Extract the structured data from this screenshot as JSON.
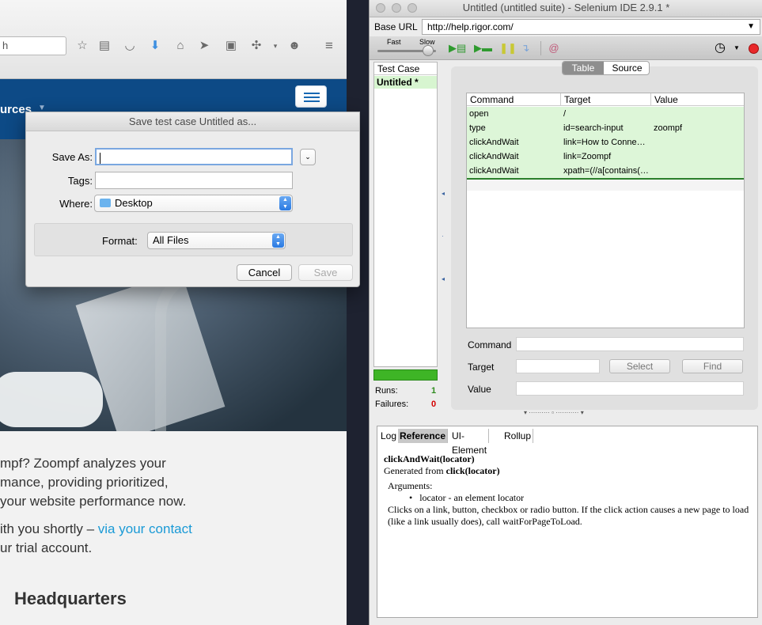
{
  "browser": {
    "search_text": "h",
    "nav_text": "urces",
    "body_lines": [
      "mpf? Zoompf analyzes your",
      "mance, providing prioritized,",
      "your website performance now."
    ],
    "contact_line_prefix": "ith you shortly – ",
    "contact_link": "via your contact",
    "contact_line2": "ur trial account.",
    "headquarters": "Headquarters"
  },
  "save_dialog": {
    "title": "Save test case Untitled as...",
    "save_as_label": "Save As:",
    "save_as_value": "",
    "tags_label": "Tags:",
    "tags_value": "",
    "where_label": "Where:",
    "where_value": "Desktop",
    "format_label": "Format:",
    "format_value": "All Files",
    "cancel_label": "Cancel",
    "save_label": "Save"
  },
  "ide": {
    "title": "Untitled (untitled suite) - Selenium IDE 2.9.1 *",
    "base_url_label": "Base URL",
    "base_url_value": "http://help.rigor.com/",
    "speed_fast": "Fast",
    "speed_slow": "Slow",
    "test_case_header": "Test Case",
    "test_case_item": "Untitled *",
    "runs_label": "Runs:",
    "runs_value": "1",
    "failures_label": "Failures:",
    "failures_value": "0",
    "tab_table": "Table",
    "tab_source": "Source",
    "columns": [
      "Command",
      "Target",
      "Value"
    ],
    "rows": [
      {
        "command": "open",
        "target": "/",
        "value": ""
      },
      {
        "command": "type",
        "target": "id=search-input",
        "value": "zoompf"
      },
      {
        "command": "clickAndWait",
        "target": "link=How to Conne…",
        "value": ""
      },
      {
        "command": "clickAndWait",
        "target": "link=Zoompf",
        "value": ""
      },
      {
        "command": "clickAndWait",
        "target": "xpath=(//a[contains(…",
        "value": ""
      }
    ],
    "command_label": "Command",
    "target_label": "Target",
    "value_label": "Value",
    "select_label": "Select",
    "find_label": "Find",
    "bottom_tabs": [
      "Log",
      "Reference",
      "UI-Element",
      "Rollup"
    ],
    "ref_signature": "clickAndWait(locator)",
    "ref_generated_prefix": "Generated from ",
    "ref_generated_from": "click(locator)",
    "ref_arguments": "Arguments:",
    "ref_arg_item": "locator - an element locator",
    "ref_description": "Clicks on a link, button, checkbox or radio button. If the click action causes a new page to load (like a link usually does), call waitForPageToLoad."
  },
  "colors": {
    "site_header": "#0d4a86",
    "link": "#1a9ad6",
    "row_highlight": "#ddf6d8",
    "progress": "#3eb526",
    "failures": "#d40000",
    "runs": "#2e8b1e"
  }
}
